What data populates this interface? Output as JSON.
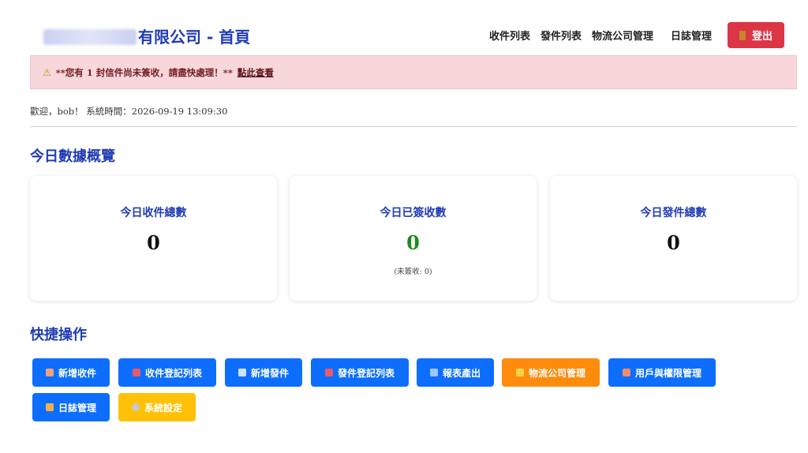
{
  "header": {
    "title": "有限公司 - 首頁",
    "nav": [
      "收件列表",
      "發件列表",
      "物流公司管理",
      "日誌管理"
    ],
    "logout_label": "登出"
  },
  "alert": {
    "message": "**您有 1 封信件尚未簽收，請盡快處理！**",
    "link_text": "點此查看"
  },
  "welcome": "歡迎，bob！ 系統時間：2026-09-19 13:09:30",
  "overview": {
    "title": "今日數據概覽",
    "cards": [
      {
        "label": "今日收件總數",
        "value": "0",
        "sub": ""
      },
      {
        "label": "今日已簽收數",
        "value": "0",
        "sub": "(未簽收: 0)"
      },
      {
        "label": "今日發件總數",
        "value": "0",
        "sub": ""
      }
    ]
  },
  "quick_actions": {
    "title": "快捷操作",
    "buttons": [
      {
        "label": "新增收件",
        "icon": "document-add-icon",
        "color": "#0d6efd"
      },
      {
        "label": "收件登記列表",
        "icon": "inbox-icon",
        "color": "#0d6efd"
      },
      {
        "label": "新增發件",
        "icon": "envelope-icon",
        "color": "#0d6efd"
      },
      {
        "label": "發件登記列表",
        "icon": "outbox-icon",
        "color": "#0d6efd"
      },
      {
        "label": "報表產出",
        "icon": "chart-icon",
        "color": "#0d6efd"
      },
      {
        "label": "物流公司管理",
        "icon": "truck-icon",
        "color": "#fd8c0d"
      },
      {
        "label": "用戶與權限管理",
        "icon": "users-icon",
        "color": "#0d6efd"
      },
      {
        "label": "日誌管理",
        "icon": "notebook-icon",
        "color": "#0d6efd"
      },
      {
        "label": "系統設定",
        "icon": "gear-icon",
        "color": "#ffc107"
      }
    ]
  },
  "colors": {
    "primary": "#0d6efd",
    "danger": "#dc3545",
    "warning": "#fd8c0d",
    "heading": "#1f3bb3",
    "alert_bg": "#f7d7da"
  }
}
